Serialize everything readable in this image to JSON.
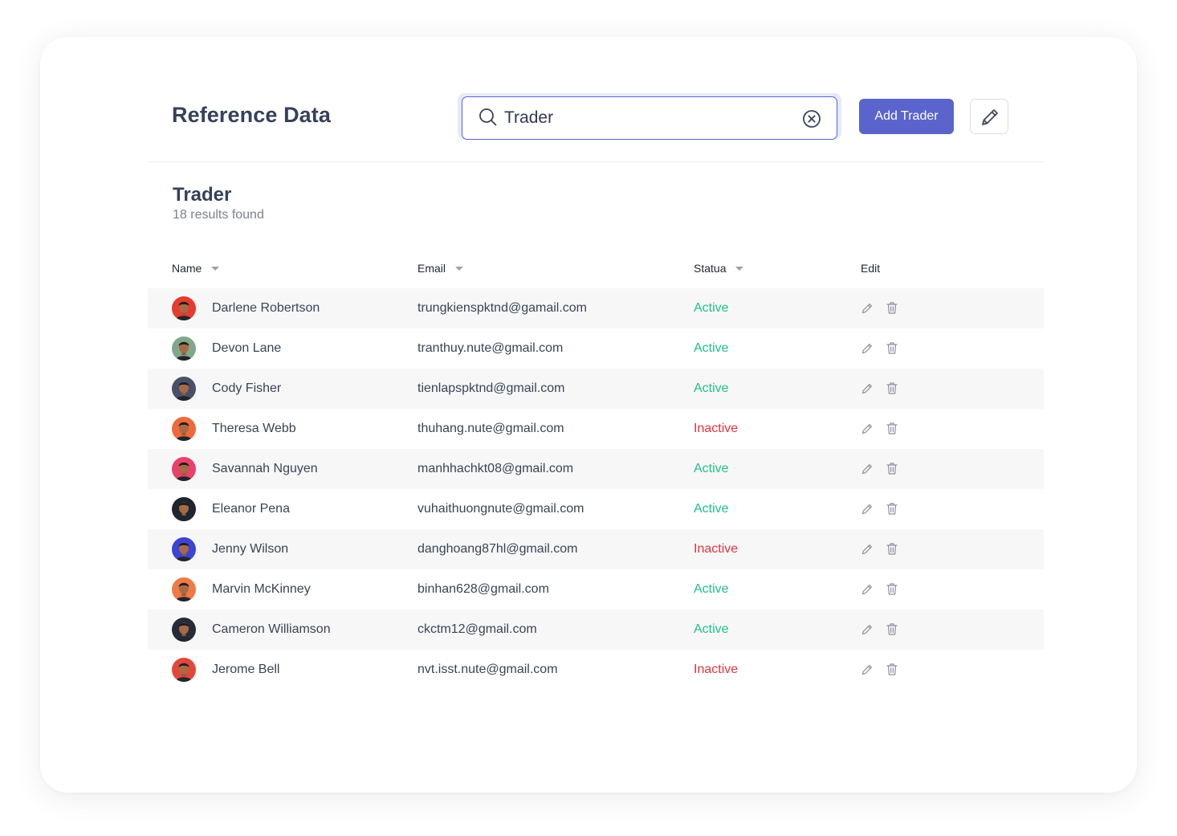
{
  "header": {
    "title": "Reference Data",
    "search": {
      "value": "Trader",
      "placeholder": ""
    },
    "add_button_label": "Add Trader"
  },
  "section": {
    "title": "Trader",
    "result_count": "18 results found"
  },
  "table": {
    "columns": [
      "Name",
      "Email",
      "Statua",
      "Edit"
    ],
    "rows": [
      {
        "name": "Darlene Robertson",
        "email": "trungkienspktnd@gamail.com",
        "status": "Active",
        "avatar_color": "#e63b2e"
      },
      {
        "name": "Devon Lane",
        "email": "tranthuy.nute@gmail.com",
        "status": "Active",
        "avatar_color": "#7fa88a"
      },
      {
        "name": "Cody Fisher",
        "email": "tienlapspktnd@gmail.com",
        "status": "Active",
        "avatar_color": "#48506a"
      },
      {
        "name": "Theresa Webb",
        "email": "thuhang.nute@gmail.com",
        "status": "Inactive",
        "avatar_color": "#ef6a3a"
      },
      {
        "name": "Savannah Nguyen",
        "email": "manhhachkt08@gmail.com",
        "status": "Active",
        "avatar_color": "#e8426a"
      },
      {
        "name": "Eleanor Pena",
        "email": "vuhaithuongnute@gmail.com",
        "status": "Active",
        "avatar_color": "#1f2631"
      },
      {
        "name": "Jenny Wilson",
        "email": "danghoang87hl@gmail.com",
        "status": "Inactive",
        "avatar_color": "#3c44d6"
      },
      {
        "name": "Marvin McKinney",
        "email": "binhan628@gmail.com",
        "status": "Active",
        "avatar_color": "#f07a45"
      },
      {
        "name": "Cameron Williamson",
        "email": "ckctm12@gmail.com",
        "status": "Active",
        "avatar_color": "#262c38"
      },
      {
        "name": "Jerome Bell",
        "email": "nvt.isst.nute@gmail.com",
        "status": "Inactive",
        "avatar_color": "#e3473c"
      }
    ]
  },
  "colors": {
    "accent": "#5a64cc",
    "active": "#21c08a",
    "inactive": "#e0353d",
    "stripe": "#f7f7f8"
  },
  "icons": {
    "search": "search-icon",
    "clear": "clear-circle-x-icon",
    "edit": "pencil-icon",
    "delete": "trash-icon",
    "sort": "caret-down-icon"
  }
}
